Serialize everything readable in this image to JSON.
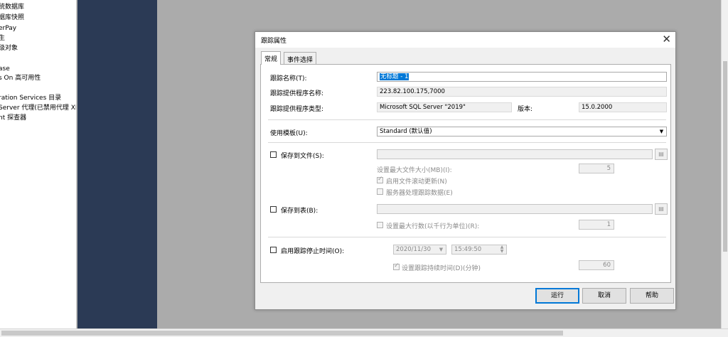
{
  "explorer": {
    "items": [
      "统数据库",
      "据库快照",
      "erPay",
      "生",
      "级对象",
      "ase",
      "s On 高可用性",
      "ration Services 目录",
      "Server 代理(已禁用代理 XP)",
      "nt 探查器"
    ]
  },
  "dialog": {
    "title": "跟踪属性",
    "close_symbol": "✕",
    "tabs": [
      "常规",
      "事件选择"
    ],
    "trace_name": {
      "label": "跟踪名称(T):",
      "value": "无标题 - 1"
    },
    "provider_name": {
      "label": "跟踪提供程序名称:",
      "value": "223.82.100.175,7000"
    },
    "provider_type": {
      "label": "跟踪提供程序类型:",
      "value": "Microsoft SQL Server \"2019\""
    },
    "version": {
      "label": "版本:",
      "value": "15.0.2000"
    },
    "template": {
      "label": "使用模板(U):",
      "value": "Standard (默认值)"
    },
    "save_to_file": {
      "label": "保存到文件(S):",
      "path_value": "",
      "max_size_label": "设置最大文件大小(MB)(I):",
      "max_size_value": "5",
      "rollover_label": "启用文件滚动更新(N)",
      "server_process_label": "服务器处理跟踪数据(E)"
    },
    "save_to_table": {
      "label": "保存到表(B):",
      "table_value": "",
      "max_rows_label": "设置最大行数(以千行为单位)(R):",
      "max_rows_value": "1"
    },
    "stop_time": {
      "label": "启用跟踪停止时间(O):",
      "date_value": "2020/11/30",
      "time_value": "15:49:50",
      "duration_label": "设置跟踪持续时间(D)(分钟)",
      "duration_value": "60"
    },
    "buttons": {
      "run": "运行",
      "cancel": "取消",
      "help": "帮助"
    }
  },
  "colors": {
    "navy_panel": "#2b3a55",
    "accent": "#0078d7",
    "workspace": "#ababab"
  }
}
